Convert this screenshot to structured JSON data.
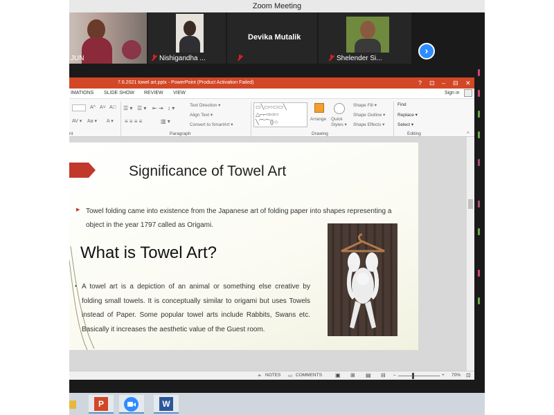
{
  "zoom": {
    "window_title": "Zoom Meeting",
    "participants": [
      {
        "name": "JUN"
      },
      {
        "name": "Nishigandha ..."
      },
      {
        "name": "Devika Mutalik"
      },
      {
        "name": "Shelender Si..."
      }
    ],
    "next_arrow": "›"
  },
  "powerpoint": {
    "title": "7.6.2021 towel art.pptx - PowerPoint (Product Activation Failed)",
    "window_controls": [
      "?",
      "⊡",
      "–",
      "⊟",
      "✕"
    ],
    "tabs": [
      "IMATIONS",
      "SLIDE SHOW",
      "REVIEW",
      "VIEW"
    ],
    "sign_in": "Sign in",
    "ribbon": {
      "groups": {
        "font": "nt",
        "paragraph": "Paragraph",
        "drawing": "Drawing",
        "editing": "Editing"
      },
      "text_direction": "Text Direction ▾",
      "align_text": "Align Text ▾",
      "convert_smartart": "Convert to SmartArt ▾",
      "arrange": "Arrange",
      "quick_styles": "Quick Styles ▾",
      "shape_fill": "Shape Fill ▾",
      "shape_outline": "Shape Outline ▾",
      "shape_effects": "Shape Effects ▾",
      "find": "Find",
      "replace": "Replace ▾",
      "select": "Select ▾"
    },
    "slide": {
      "title": "Significance of Towel Art",
      "bullet1": "Towel folding came into existence from the Japanese art of folding paper into shapes representing a object in the year 1797 called as Origami.",
      "heading2": "What is Towel Art?",
      "bullet2": "A towel art is a depiction of an animal or something else creative by folding small towels. It is conceptually similar to origami but uses Towels instead of Paper. Some popular towel arts include Rabbits, Swans etc. Basically it increases the aesthetic value of the Guest room."
    },
    "status": {
      "notes": "NOTES",
      "comments": "COMMENTS",
      "zoom": "70%"
    }
  },
  "colors": {
    "ppt_red": "#d24726",
    "zoom_blue": "#2d8cff",
    "arrow_red": "#c0392b"
  }
}
